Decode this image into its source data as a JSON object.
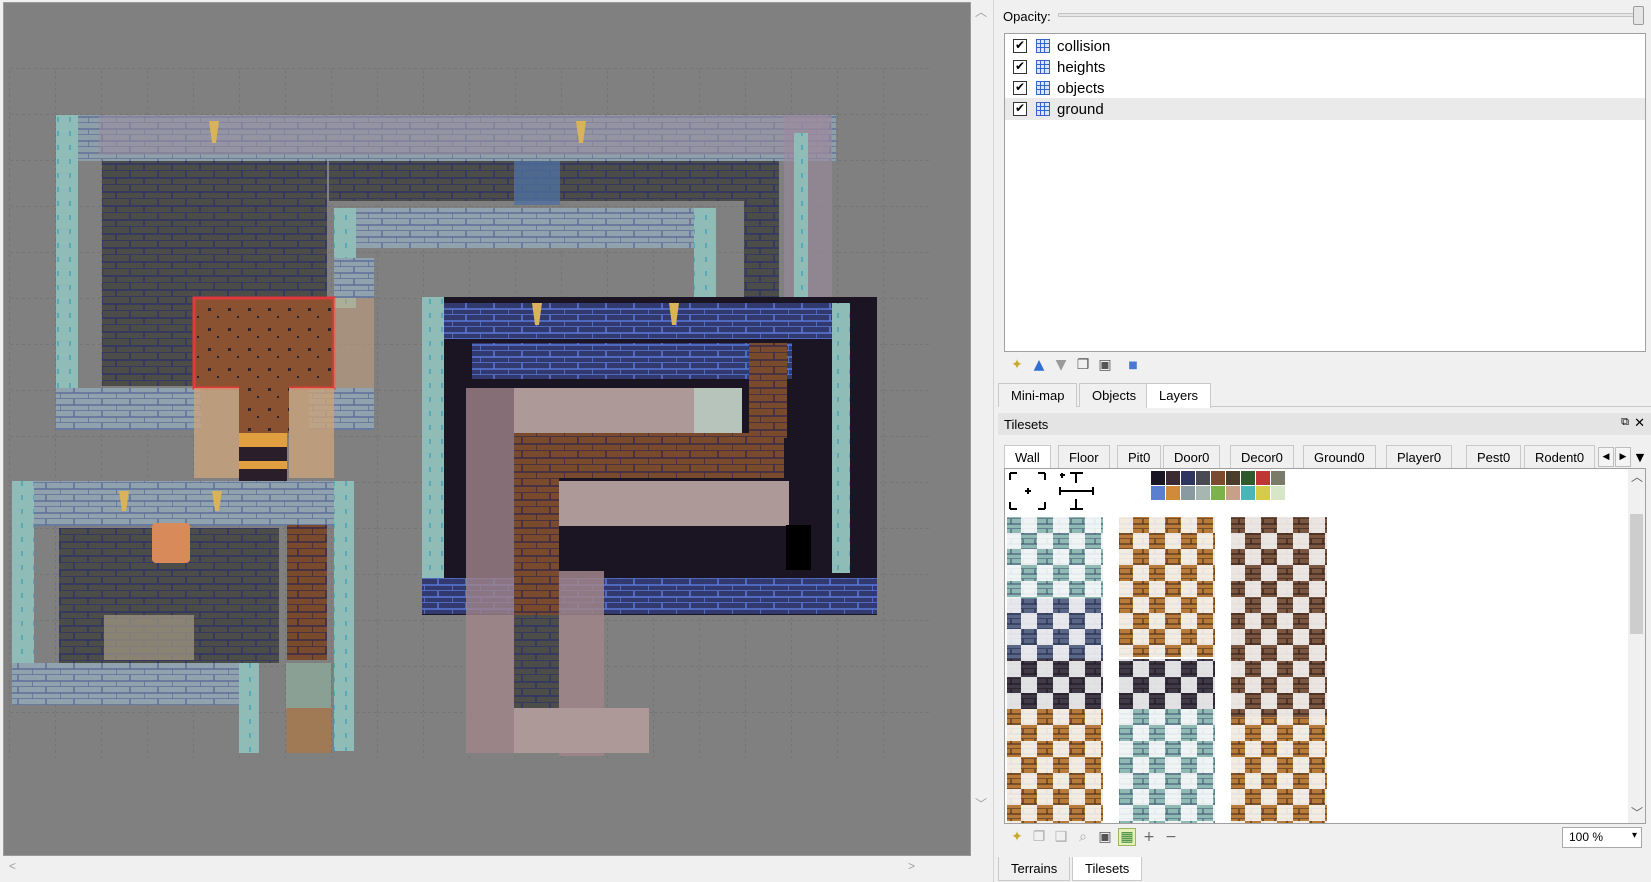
{
  "opacity": {
    "label": "Opacity:",
    "value": 1.0
  },
  "layers": [
    {
      "name": "collision",
      "visible": true,
      "selected": false
    },
    {
      "name": "heights",
      "visible": true,
      "selected": false
    },
    {
      "name": "objects",
      "visible": true,
      "selected": false
    },
    {
      "name": "ground",
      "visible": true,
      "selected": true
    }
  ],
  "layer_toolbar_icons": [
    "new-layer-icon",
    "raise-layer-icon",
    "lower-layer-icon",
    "duplicate-layer-icon",
    "delete-layer-icon",
    "layer-properties-icon"
  ],
  "dock_tabs": [
    "Mini-map",
    "Objects",
    "Layers"
  ],
  "active_dock_tab": "Layers",
  "tilesets": {
    "title": "Tilesets",
    "tabs": [
      "Wall",
      "Floor",
      "Pit0",
      "Door0",
      "Decor0",
      "Ground0",
      "Player0",
      "Pest0",
      "Rodent0"
    ],
    "active_tab": "Wall",
    "palette_colors": [
      "#1a1523",
      "#3b2a33",
      "#2f3560",
      "#4a4a55",
      "#7a4b2f",
      "#4c3d2b",
      "#2e5a2c",
      "#c03636",
      "#7b7b6a",
      "#5a7fd1",
      "#d08a3a",
      "#8a9aa0",
      "#a6b7b0",
      "#7bb34a",
      "#c8a08a",
      "#4ab6b9",
      "#d6cc4a",
      "#d8e6c8"
    ],
    "zoom": "100 %"
  },
  "bottom_tabs": [
    "Terrains",
    "Tilesets"
  ],
  "active_bottom_tab": "Tilesets"
}
